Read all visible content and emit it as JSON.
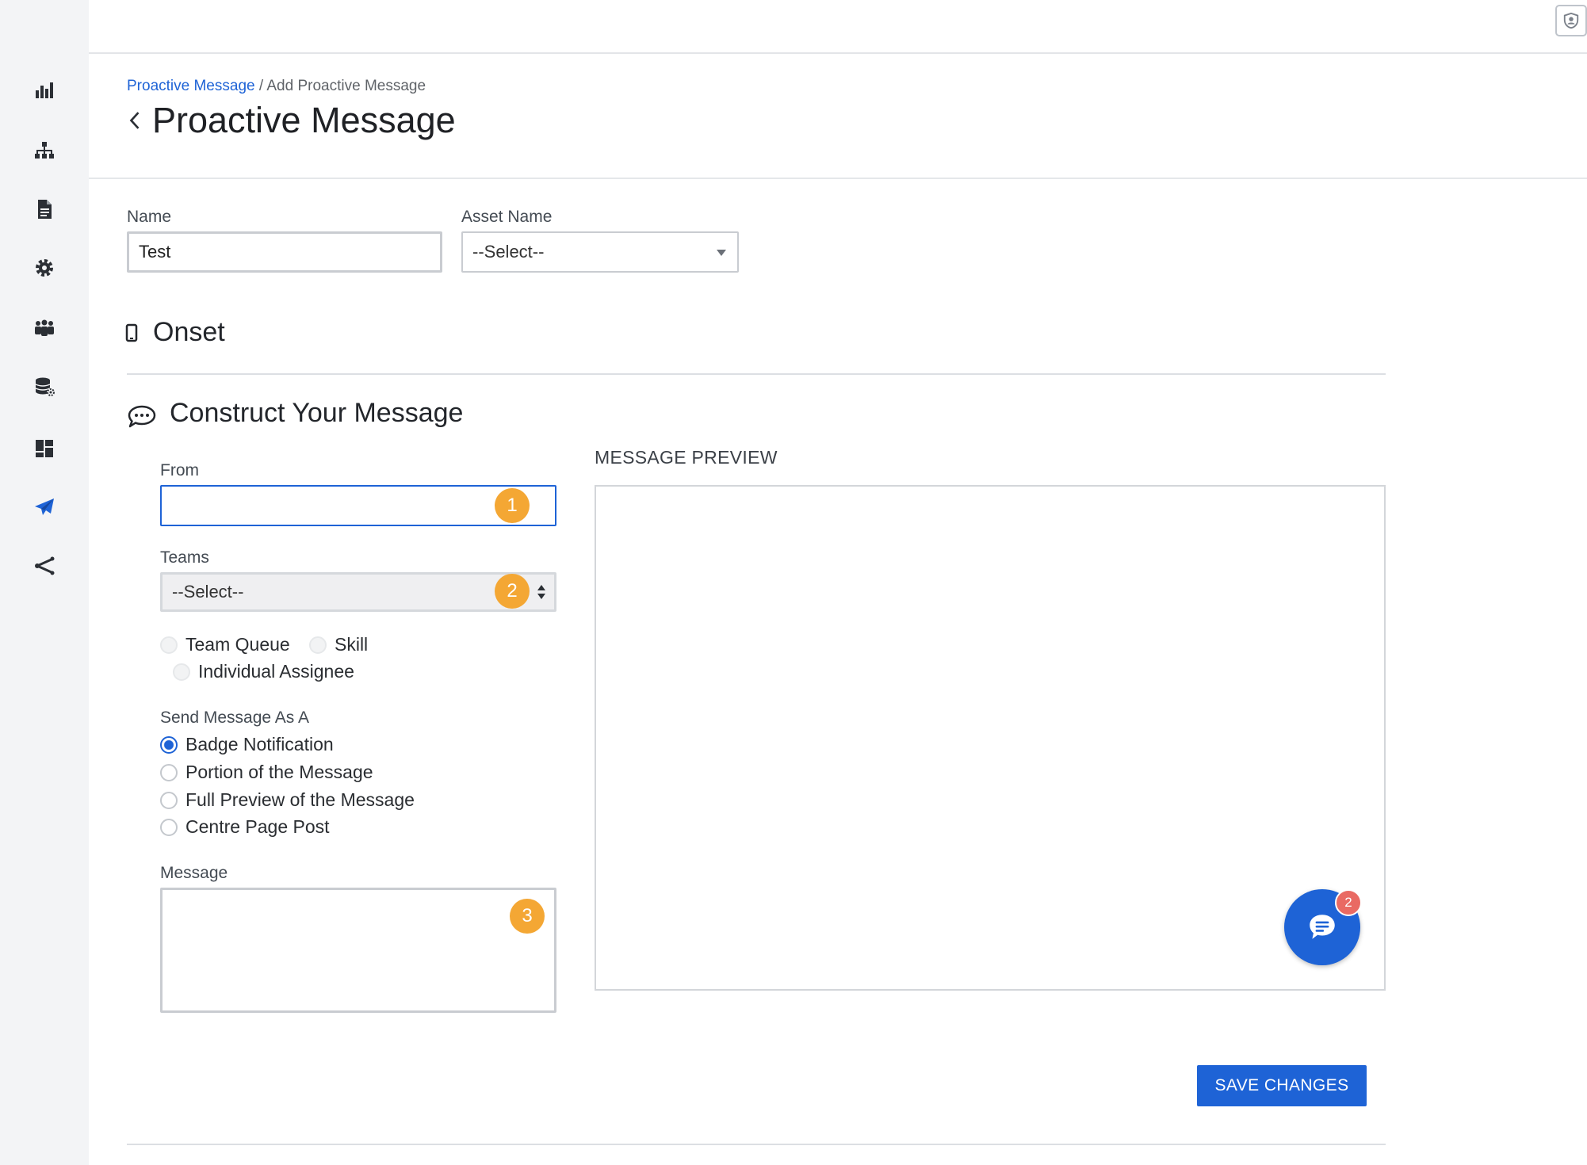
{
  "sidebar": {
    "items": [
      {
        "icon": "bar-chart-icon",
        "active": false
      },
      {
        "icon": "sitemap-icon",
        "active": false
      },
      {
        "icon": "document-icon",
        "active": false
      },
      {
        "icon": "gear-icon",
        "active": false
      },
      {
        "icon": "users-group-icon",
        "active": false
      },
      {
        "icon": "database-settings-icon",
        "active": false
      },
      {
        "icon": "dashboard-icon",
        "active": false
      },
      {
        "icon": "paper-plane-icon",
        "active": true
      },
      {
        "icon": "share-icon",
        "active": false
      }
    ]
  },
  "header": {
    "profile_icon": "user-shield-icon"
  },
  "breadcrumb": {
    "parent": "Proactive Message",
    "separator": " / ",
    "current": "Add Proactive Message"
  },
  "page": {
    "title": "Proactive Message"
  },
  "form": {
    "name": {
      "label": "Name",
      "value": "Test"
    },
    "asset": {
      "label": "Asset Name",
      "selected": "--Select--"
    }
  },
  "onset": {
    "title": "Onset",
    "icon": "mobile-icon"
  },
  "construct": {
    "title": "Construct Your Message",
    "icon": "chat-bubble-icon",
    "from": {
      "label": "From",
      "value": "",
      "marker": "1"
    },
    "teams": {
      "label": "Teams",
      "selected": "--Select--",
      "marker": "2"
    },
    "assign_options": [
      {
        "label": "Team Queue"
      },
      {
        "label": "Skill"
      },
      {
        "label": "Individual Assignee"
      }
    ],
    "send_as": {
      "label": "Send Message As A",
      "options": [
        {
          "label": "Badge Notification",
          "checked": true
        },
        {
          "label": "Portion of the Message",
          "checked": false
        },
        {
          "label": "Full Preview of the Message",
          "checked": false
        },
        {
          "label": "Centre Page Post",
          "checked": false
        }
      ]
    },
    "message": {
      "label": "Message",
      "value": "",
      "marker": "3"
    }
  },
  "preview": {
    "label": "MESSAGE PREVIEW",
    "chat_count": "2"
  },
  "actions": {
    "save_label": "SAVE CHANGES"
  },
  "colors": {
    "primary": "#1e63d6",
    "marker": "#f4a734",
    "notification": "#e96a63",
    "sidebar_bg": "#f3f4f6"
  }
}
